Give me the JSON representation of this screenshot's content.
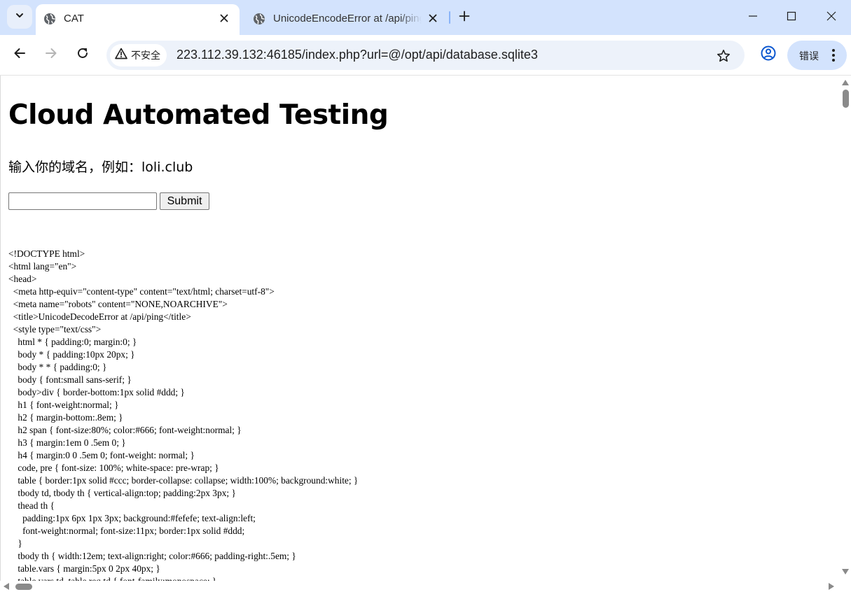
{
  "browser": {
    "tabs": [
      {
        "title": "CAT",
        "active": true
      },
      {
        "title": "UnicodeEncodeError at /api/ping",
        "active": false
      }
    ],
    "address_bar": {
      "security_label": "不安全",
      "url": "223.112.39.132:46185/index.php?url=@/opt/api/database.sqlite3"
    },
    "error_chip_label": "错误",
    "colors": {
      "tabstrip": "#d3e3fd",
      "omnibox": "#edf2fa",
      "icon": "#1f1f1f",
      "profile": "#0b57d0"
    }
  },
  "page": {
    "title": "Cloud Automated Testing",
    "prompt": "输入你的域名，例如：loli.club",
    "input": {
      "value": "",
      "placeholder": ""
    },
    "submit_label": "Submit",
    "source_lines": [
      "<!DOCTYPE html>",
      "<html lang=\"en\">",
      "<head>",
      "  <meta http-equiv=\"content-type\" content=\"text/html; charset=utf-8\">",
      "  <meta name=\"robots\" content=\"NONE,NOARCHIVE\">",
      "  <title>UnicodeDecodeError at /api/ping</title>",
      "  <style type=\"text/css\">",
      "    html * { padding:0; margin:0; }",
      "    body * { padding:10px 20px; }",
      "    body * * { padding:0; }",
      "    body { font:small sans-serif; }",
      "    body>div { border-bottom:1px solid #ddd; }",
      "    h1 { font-weight:normal; }",
      "    h2 { margin-bottom:.8em; }",
      "    h2 span { font-size:80%; color:#666; font-weight:normal; }",
      "    h3 { margin:1em 0 .5em 0; }",
      "    h4 { margin:0 0 .5em 0; font-weight: normal; }",
      "    code, pre { font-size: 100%; white-space: pre-wrap; }",
      "    table { border:1px solid #ccc; border-collapse: collapse; width:100%; background:white; }",
      "    tbody td, tbody th { vertical-align:top; padding:2px 3px; }",
      "    thead th {",
      "      padding:1px 6px 1px 3px; background:#fefefe; text-align:left;",
      "      font-weight:normal; font-size:11px; border:1px solid #ddd;",
      "    }",
      "    tbody th { width:12em; text-align:right; color:#666; padding-right:.5em; }",
      "    table.vars { margin:5px 0 2px 40px; }",
      "    table.vars td, table.req td { font-family:monospace; }"
    ]
  }
}
